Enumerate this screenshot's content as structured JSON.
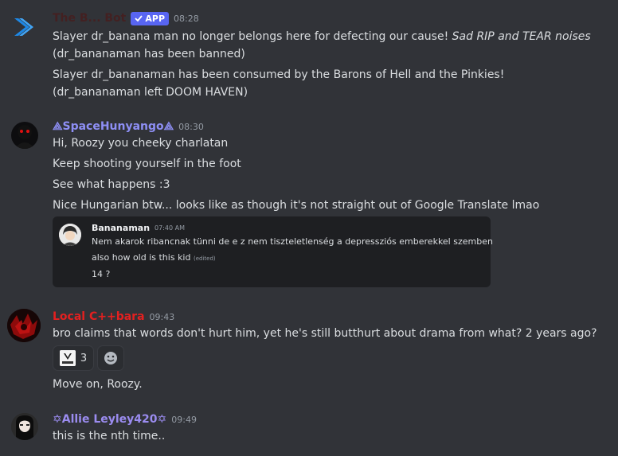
{
  "messages": [
    {
      "username": "The B... Bot",
      "badge": "APP",
      "time": "08:28",
      "lines": [
        {
          "text": "Slayer dr_banana man no longer belongs here for defecting our cause!",
          "emph": "Sad RIP and TEAR noises"
        },
        {
          "text": "(dr_bananaman has been banned)"
        },
        {
          "text": "Slayer dr_bananaman has been consumed by the Barons of Hell and the Pinkies!"
        },
        {
          "text": "(dr_bananaman left DOOM HAVEN)"
        }
      ]
    },
    {
      "username": "⟁SpaceHunyango⟁",
      "time": "08:30",
      "lines": [
        {
          "text": "Hi, Roozy you cheeky charlatan"
        },
        {
          "text": "Keep shooting yourself in the foot"
        },
        {
          "text": "See what happens :3"
        },
        {
          "text": "Nice Hungarian btw... looks like as though it's not straight out of Google Translate lmao"
        }
      ],
      "quote": {
        "author": "Bananaman",
        "time": "07:40 AM",
        "lines": [
          {
            "text": "Nem akarok ribancnak tünni de e z nem tiszteletlenség a depressziós emberekkel szemben"
          },
          {
            "text": "also how old is this kid",
            "edited": "(edited)"
          },
          {
            "text": "14 ?"
          }
        ]
      }
    },
    {
      "username": "Local C++bara",
      "time": "09:43",
      "lines": [
        {
          "text": "bro claims that words don't hurt him, yet he's still butthurt about drama from what? 2 years ago?"
        },
        {
          "text": "Move on, Roozy."
        }
      ],
      "reactions": [
        {
          "emoji": "custom-image",
          "count": "3"
        },
        {
          "emoji": "add-reaction-icon"
        }
      ]
    },
    {
      "username": "✡Allie Leyley420✡",
      "time": "09:49",
      "lines": [
        {
          "text": "this is the nth time.."
        }
      ]
    }
  ]
}
